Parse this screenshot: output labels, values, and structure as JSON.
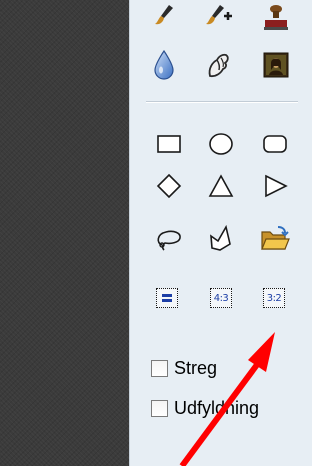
{
  "canvas": {
    "color": "#3b3b3b"
  },
  "panel": {
    "background": "#e7eef4",
    "tools_top": [
      {
        "name": "brush",
        "icon": "brush-icon"
      },
      {
        "name": "brush-add",
        "icon": "brush-plus-icon"
      },
      {
        "name": "stamp",
        "icon": "stamp-icon"
      },
      {
        "name": "drop",
        "icon": "drop-icon"
      },
      {
        "name": "smudge",
        "icon": "smudge-icon"
      },
      {
        "name": "photo",
        "icon": "portrait-icon"
      }
    ],
    "shapes": [
      {
        "name": "rectangle",
        "icon": "rectangle-icon"
      },
      {
        "name": "ellipse",
        "icon": "ellipse-icon"
      },
      {
        "name": "rounded-rectangle",
        "icon": "rounded-rectangle-icon"
      },
      {
        "name": "diamond",
        "icon": "diamond-icon"
      },
      {
        "name": "triangle",
        "icon": "triangle-icon"
      },
      {
        "name": "right-triangle",
        "icon": "right-triangle-icon"
      },
      {
        "name": "lasso",
        "icon": "lasso-icon"
      },
      {
        "name": "polygon",
        "icon": "polygon-icon"
      },
      {
        "name": "open-folder",
        "icon": "folder-open-icon"
      }
    ],
    "ratios": {
      "free_icon": "equals-icon",
      "r43": "4:3",
      "r32": "3:2"
    },
    "options": {
      "stroke_label": "Streg",
      "stroke_checked": false,
      "fill_label": "Udfyldning",
      "fill_checked": false
    }
  },
  "annotation": {
    "color": "#ff0000",
    "icon": "red-arrow-icon"
  }
}
